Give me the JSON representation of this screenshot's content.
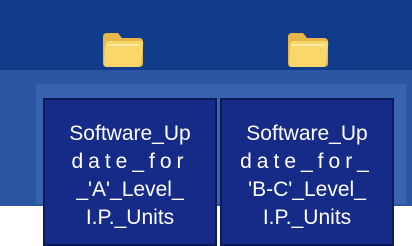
{
  "desktop": {
    "items": [
      {
        "icon": "folder-icon",
        "lines": [
          "Software_Up",
          "date_for",
          "_'A'_Level_",
          "I.P._Units"
        ]
      },
      {
        "icon": "folder-icon",
        "lines": [
          "Software_Up",
          "date_for_",
          "'B-C'_Level_",
          "I.P._Units"
        ]
      }
    ]
  },
  "colors": {
    "desktop_background": "#113c8c",
    "selection_label": "#162a88",
    "folder_yellow": "#f8d66a"
  }
}
